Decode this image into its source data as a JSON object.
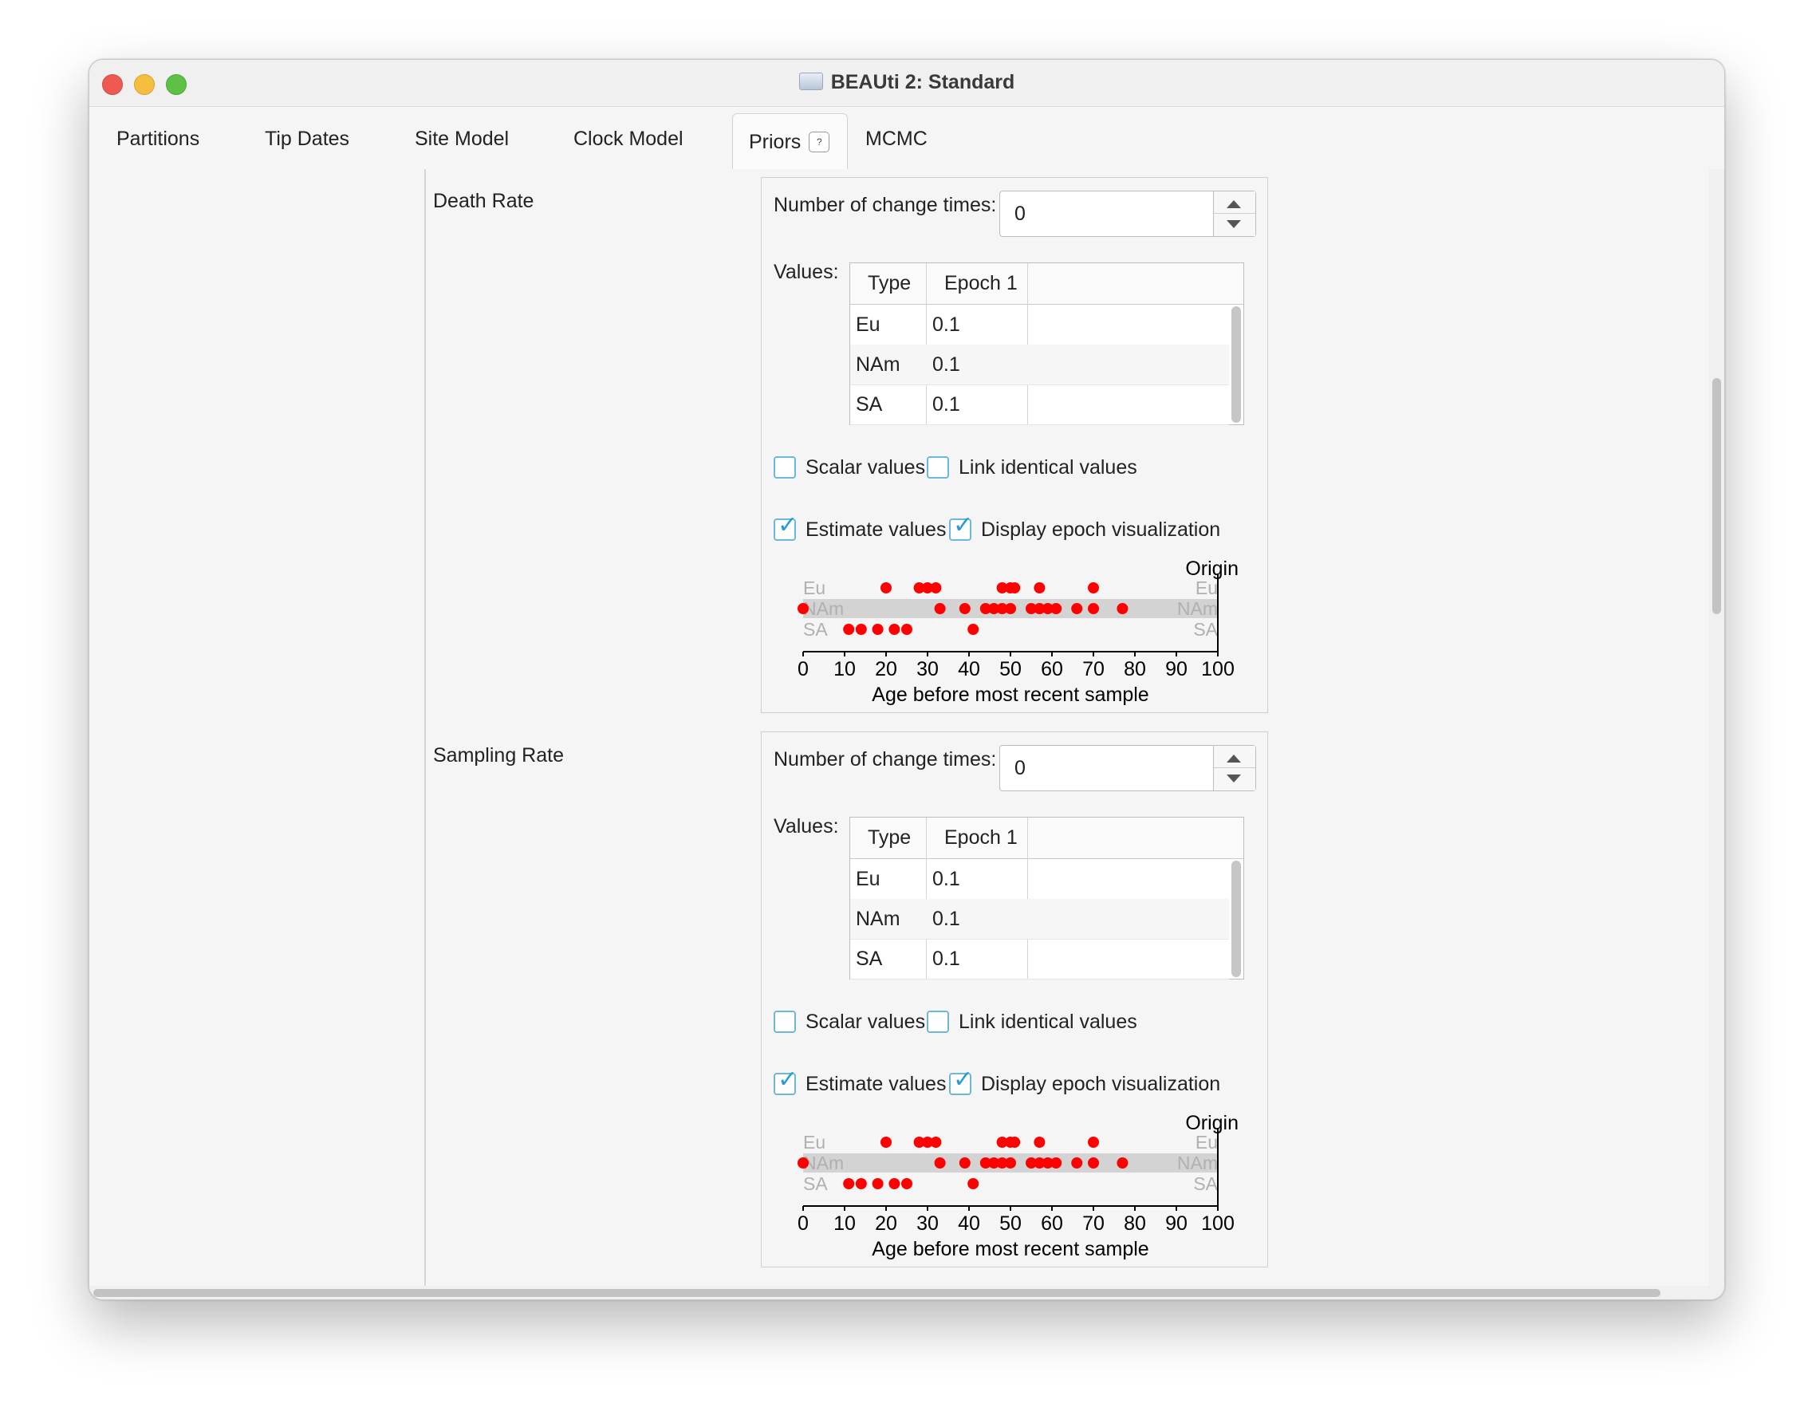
{
  "window": {
    "title": "BEAUti 2: Standard"
  },
  "tabs": [
    {
      "label": "Partitions"
    },
    {
      "label": "Tip Dates"
    },
    {
      "label": "Site Model"
    },
    {
      "label": "Clock Model"
    },
    {
      "label": "Priors",
      "help": "?"
    },
    {
      "label": "MCMC"
    }
  ],
  "active_tab": "Priors",
  "sections": [
    {
      "label": "Death Rate",
      "change_times_label": "Number of change times:",
      "change_times_value": "0",
      "values_label": "Values:",
      "table": {
        "headers": [
          "Type",
          "Epoch 1"
        ],
        "rows": [
          [
            "Eu",
            "0.1"
          ],
          [
            "NAm",
            "0.1"
          ],
          [
            "SA",
            "0.1"
          ]
        ]
      },
      "checkboxes": {
        "scalar": {
          "label": "Scalar values",
          "checked": false
        },
        "link": {
          "label": "Link identical values",
          "checked": false
        },
        "estimate": {
          "label": "Estimate values",
          "checked": true
        },
        "display": {
          "label": "Display epoch visualization",
          "checked": true
        }
      }
    },
    {
      "label": "Sampling Rate",
      "change_times_label": "Number of change times:",
      "change_times_value": "0",
      "values_label": "Values:",
      "table": {
        "headers": [
          "Type",
          "Epoch 1"
        ],
        "rows": [
          [
            "Eu",
            "0.1"
          ],
          [
            "NAm",
            "0.1"
          ],
          [
            "SA",
            "0.1"
          ]
        ]
      },
      "checkboxes": {
        "scalar": {
          "label": "Scalar values",
          "checked": false
        },
        "link": {
          "label": "Link identical values",
          "checked": false
        },
        "estimate": {
          "label": "Estimate values",
          "checked": true
        },
        "display": {
          "label": "Display epoch visualization",
          "checked": true
        }
      }
    }
  ],
  "chart_data": {
    "type": "scatter",
    "origin_label": "Origin",
    "xlabel": "Age before most recent sample",
    "xlim": [
      0,
      100
    ],
    "xticks": [
      0,
      10,
      20,
      30,
      40,
      50,
      60,
      70,
      80,
      90,
      100
    ],
    "categories": [
      "Eu",
      "NAm",
      "SA"
    ],
    "highlighted_category": "NAm",
    "point_color": "#ff0000",
    "band_color": "#d3d3d3",
    "series": [
      {
        "name": "Eu",
        "x": [
          20,
          28,
          30,
          32,
          48,
          50,
          51,
          57,
          70
        ]
      },
      {
        "name": "NAm",
        "x": [
          0,
          33,
          39,
          44,
          46,
          48,
          50,
          55,
          57,
          59,
          61,
          66,
          70,
          77
        ]
      },
      {
        "name": "SA",
        "x": [
          11,
          14,
          18,
          22,
          25,
          41
        ]
      }
    ]
  }
}
